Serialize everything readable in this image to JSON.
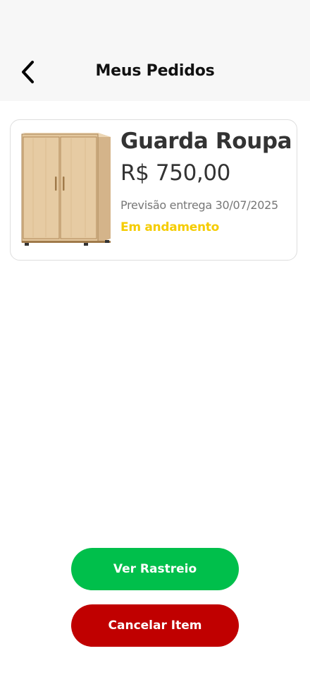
{
  "header": {
    "title": "Meus Pedidos",
    "back_icon": "chevron-left-icon"
  },
  "order": {
    "product_name": "Guarda Roupa",
    "price": "R$ 750,00",
    "delivery_forecast": "Previsão entrega 30/07/2025",
    "status": "Em andamento",
    "status_color": "#f5cc00",
    "image": "wardrobe-image"
  },
  "actions": {
    "track_label": "Ver Rastreio",
    "track_color": "#00bf4b",
    "cancel_label": "Cancelar Item",
    "cancel_color": "#c00000"
  }
}
